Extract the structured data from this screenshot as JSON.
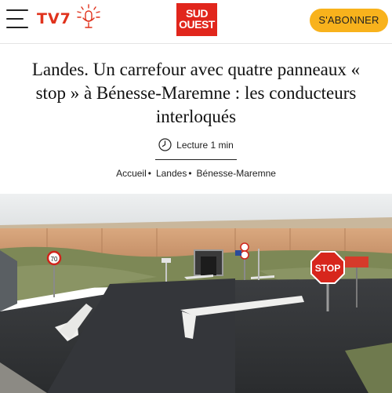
{
  "header": {
    "tv_label": "TV7",
    "logo_line1": "SUD",
    "logo_line2": "OUEST",
    "subscribe_label": "S'ABONNER"
  },
  "article": {
    "title": "Landes. Un carrefour avec quatre panneaux « stop » à Bénesse-Maremne : les conducteurs interloqués",
    "reading_time": "Lecture 1 min",
    "breadcrumb": [
      "Accueil",
      "Landes",
      "Bénesse-Maremne"
    ],
    "breadcrumb_separator": "•"
  },
  "photo": {
    "stop_sign_text": "STOP",
    "speed_limit": "70"
  },
  "colors": {
    "brand_red": "#e1261c",
    "subscribe_yellow": "#f8b21c"
  }
}
